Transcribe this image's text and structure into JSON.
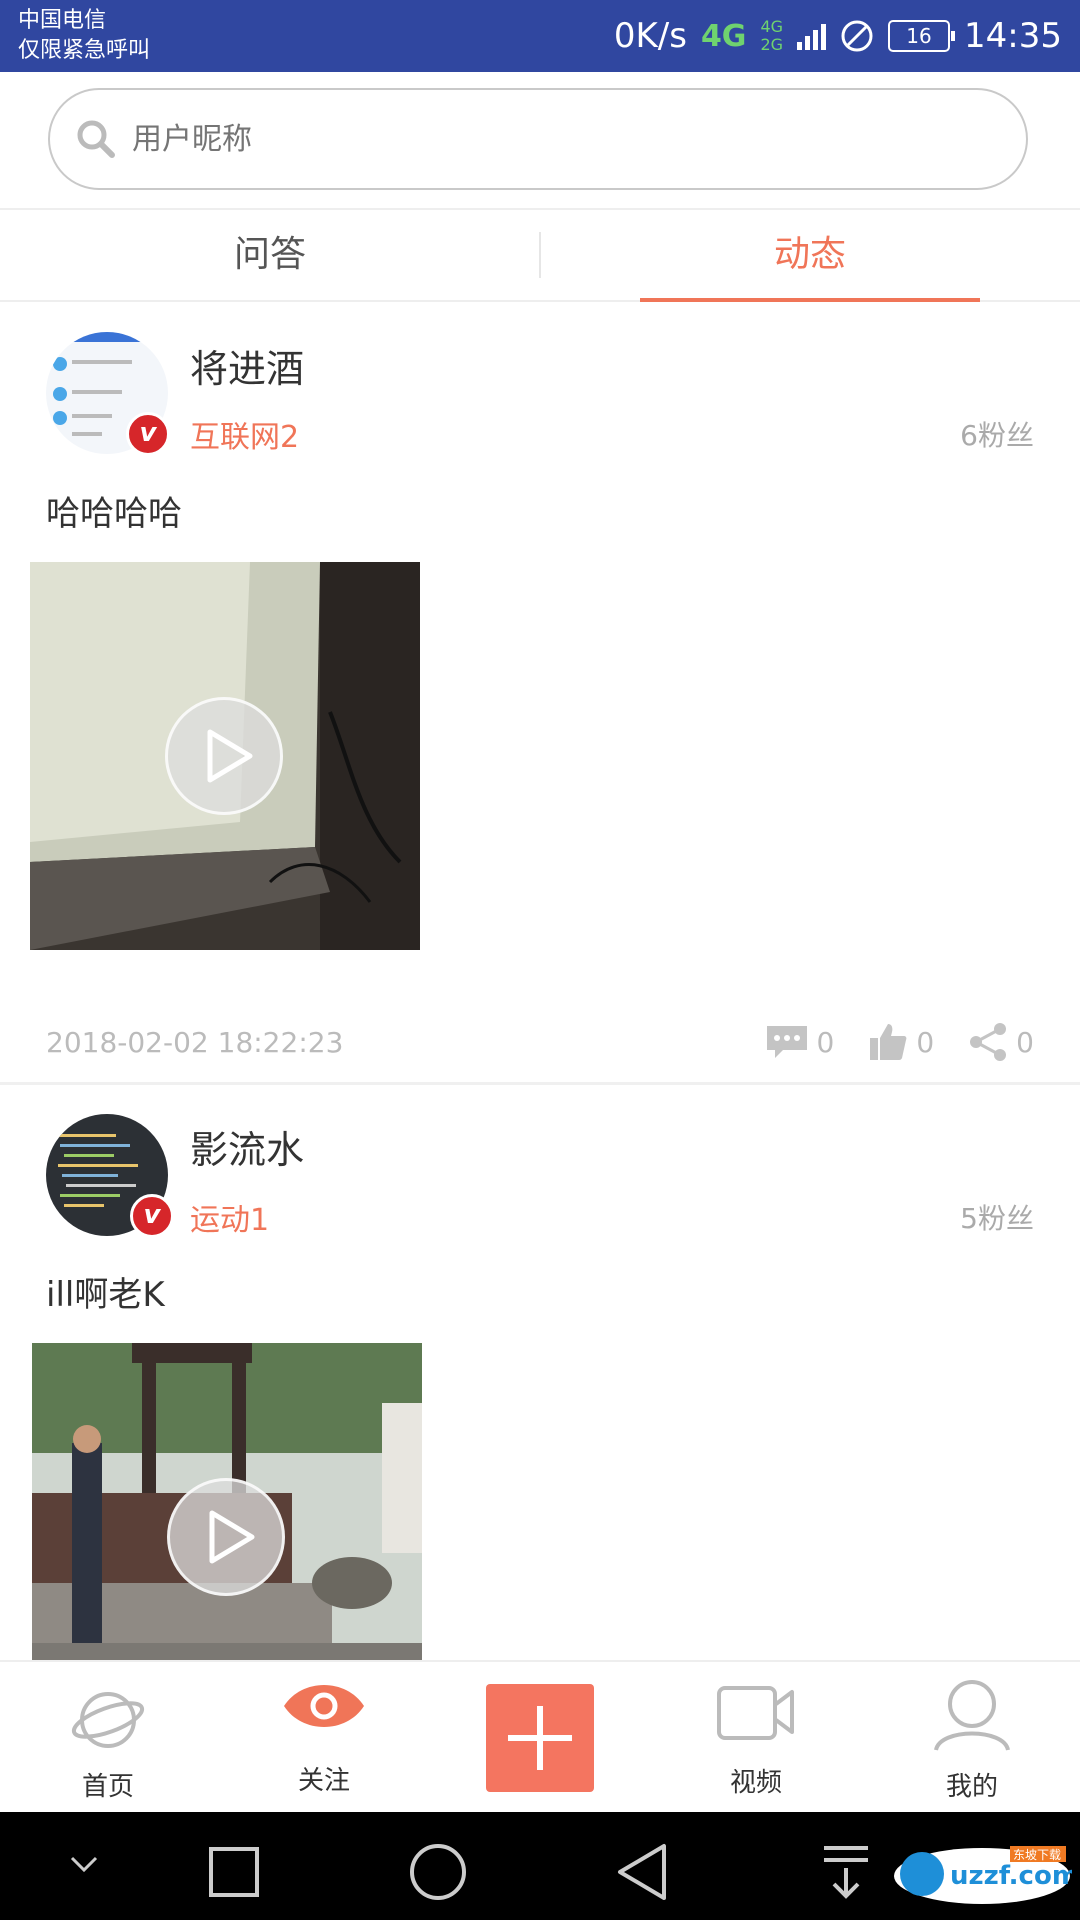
{
  "status_bar": {
    "carrier_line1": "中国电信",
    "carrier_line2": "仅限紧急呼叫",
    "speed": "0K/s",
    "network": "4G",
    "network_small_top": "4G",
    "network_small_bottom": "2G",
    "battery": "16",
    "time": "14:35",
    "background_color": "#3047a0"
  },
  "search": {
    "placeholder": "用户昵称"
  },
  "tabs": {
    "items": [
      {
        "label": "问答",
        "active": false
      },
      {
        "label": "动态",
        "active": true
      }
    ],
    "accent_color": "#f07558"
  },
  "posts": [
    {
      "username": "将进酒",
      "category": "互联网2",
      "fans": "6粉丝",
      "text": "哈哈哈哈",
      "badge": "v",
      "time": "2018-02-02 18:22:23",
      "comments": "0",
      "likes": "0",
      "shares": "0"
    },
    {
      "username": "影流水",
      "category": "运动1",
      "fans": "5粉丝",
      "text": "ill啊老K",
      "badge": "v"
    }
  ],
  "bottom_nav": {
    "items": [
      {
        "label": "首页",
        "icon": "planet-icon"
      },
      {
        "label": "关注",
        "icon": "eye-icon",
        "active": true
      },
      {
        "label": "",
        "icon": "plus-icon"
      },
      {
        "label": "视频",
        "icon": "video-camera-icon"
      },
      {
        "label": "我的",
        "icon": "user-icon"
      }
    ]
  },
  "watermark": {
    "text": "uzzf.com",
    "subtext": "东坡下载"
  }
}
